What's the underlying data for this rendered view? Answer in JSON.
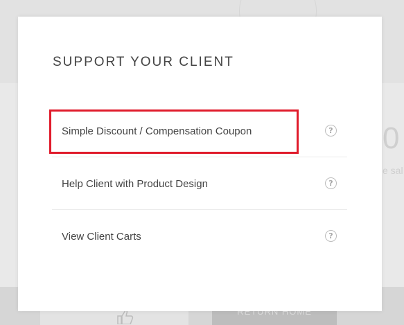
{
  "modal": {
    "title": "SUPPORT YOUR CLIENT",
    "options": [
      {
        "label": "Simple Discount / Compensation Coupon",
        "help_icon": "question-circle-icon",
        "highlighted": true
      },
      {
        "label": "Help Client with Product Design",
        "help_icon": "question-circle-icon",
        "highlighted": false
      },
      {
        "label": "View Client Carts",
        "help_icon": "question-circle-icon",
        "highlighted": false
      }
    ],
    "help_glyph": "?",
    "highlight_color": "#e01b2b"
  },
  "background": {
    "stat_value": "0",
    "stat_caption": "e sal",
    "return_button_label": "RETURN HOME",
    "like_icon": "thumbs-up-icon"
  }
}
